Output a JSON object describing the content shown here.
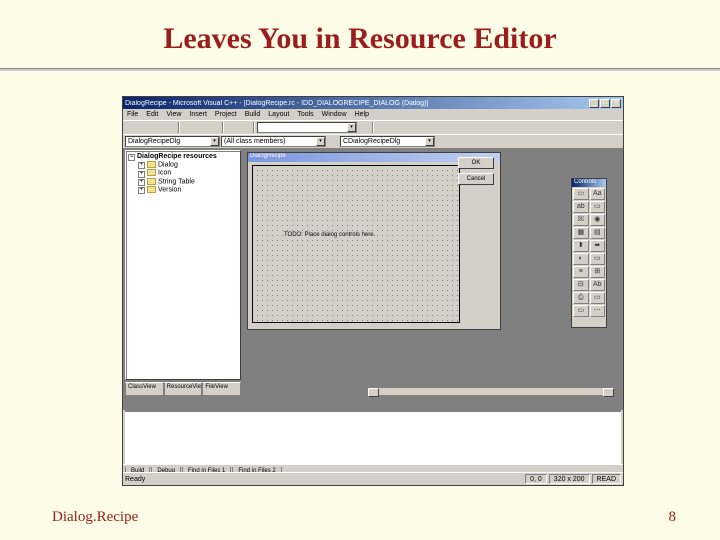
{
  "slide": {
    "title": "Leaves You in Resource Editor",
    "footer_left": "Dialog.Recipe",
    "page_number": "8"
  },
  "ide": {
    "window_title": "DialogRecipe - Microsoft Visual C++ - [DialogRecipe.rc - IDD_DIALOGRECIPE_DIALOG (Dialog)]",
    "menus": [
      "File",
      "Edit",
      "View",
      "Insert",
      "Project",
      "Build",
      "Layout",
      "Tools",
      "Window",
      "Help"
    ],
    "combos": {
      "config": "DialogRecipeDlg",
      "members": "(All class members)",
      "filter": "CDialogRecipeDlg"
    },
    "tree": {
      "root": "DialogRecipe resources",
      "items": [
        "Dialog",
        "Icon",
        "String Table",
        "Version"
      ]
    },
    "tree_tabs": [
      "ClassView",
      "ResourceView",
      "FileView"
    ],
    "dialog": {
      "title": "DialogRecipe",
      "static_text": "TODO: Place dialog controls here.",
      "ok": "OK",
      "cancel": "Cancel"
    },
    "toolbox": {
      "title": "Controls",
      "tools": [
        "▭",
        "Aa",
        "ab",
        "▭",
        "☒",
        "◉",
        "▦",
        "▤",
        "⬍",
        "⬌",
        "◐",
        "▭",
        "≡",
        "⊞",
        "⊟",
        "Ab",
        "⎙",
        "▭",
        "▭",
        "⋯"
      ]
    },
    "output_tabs": [
      "Build",
      "Debug",
      "Find in Files 1",
      "Find in Files 2"
    ],
    "status": {
      "ready": "Ready",
      "pos": "0, 0",
      "size": "320 x 200",
      "read": "READ"
    },
    "winbtns": {
      "min": "_",
      "max": "□",
      "close": "×"
    }
  }
}
